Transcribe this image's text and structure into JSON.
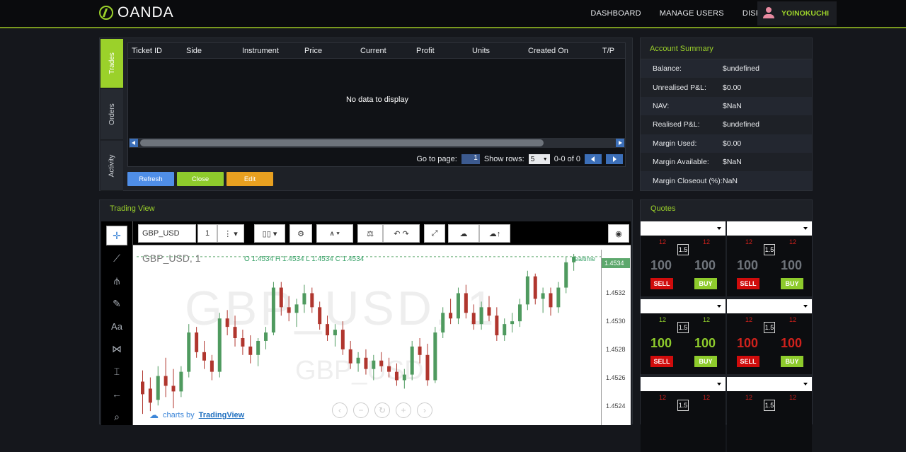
{
  "brand": {
    "name": "OANDA"
  },
  "nav": {
    "items": [
      "DASHBOARD",
      "MANAGE USERS",
      "DISPUTE MANAGEMENT"
    ],
    "username": "YOINOKUCHI"
  },
  "trades": {
    "tabs": [
      "Trades",
      "Orders",
      "Activity"
    ],
    "columns": [
      "Ticket ID",
      "Side",
      "Instrument",
      "Price",
      "Current",
      "Profit",
      "Units",
      "Created On",
      "T/P"
    ],
    "empty_text": "No data to display",
    "pager": {
      "goto_label": "Go to page:",
      "page": "1",
      "rows_label": "Show rows:",
      "rows": "5",
      "range": "0-0 of 0"
    },
    "buttons": {
      "refresh": "Refresh",
      "close": "Close",
      "edit": "Edit"
    }
  },
  "account": {
    "title": "Account Summary",
    "rows": [
      {
        "label": "Balance:",
        "value": "$undefined"
      },
      {
        "label": "Unrealised P&L:",
        "value": "$0.00"
      },
      {
        "label": "NAV:",
        "value": "$NaN"
      },
      {
        "label": "Realised P&L:",
        "value": "$undefined"
      },
      {
        "label": "Margin Used:",
        "value": "$0.00"
      },
      {
        "label": "Margin Available:",
        "value": "$NaN"
      },
      {
        "label": "Margin Closeout (%):",
        "value": "NaN"
      }
    ]
  },
  "trading_view": {
    "title": "Trading View",
    "symbol": "GBP_USD",
    "interval": "1",
    "legend": "GBP_USD, 1",
    "ohlc": "O 1.4534  H 1.4534  L 1.4534  C 1.4534",
    "watermark_big": "GBP_USD, 1",
    "watermark_small": "GBP_USD",
    "last_price": "1.4534",
    "price_ticks": [
      "1.4532",
      "1.4530",
      "1.4528",
      "1.4526",
      "1.4524"
    ],
    "realtime_label": "realtime",
    "credit_prefix": "charts by",
    "credit_brand": "TradingView",
    "candles": [
      [
        1.45251,
        1.45259,
        1.45228,
        1.45242
      ],
      [
        1.45246,
        1.45254,
        1.4523,
        1.45236
      ],
      [
        1.45238,
        1.45262,
        1.45234,
        1.45255
      ],
      [
        1.45255,
        1.45268,
        1.4524,
        1.45248
      ],
      [
        1.45248,
        1.4526,
        1.45232,
        1.45244
      ],
      [
        1.45244,
        1.45262,
        1.4524,
        1.45258
      ],
      [
        1.45258,
        1.45292,
        1.45254,
        1.45286
      ],
      [
        1.45286,
        1.4529,
        1.45268,
        1.45272
      ],
      [
        1.45272,
        1.4528,
        1.4526,
        1.45266
      ],
      [
        1.45266,
        1.4527,
        1.45252,
        1.45258
      ],
      [
        1.45258,
        1.453,
        1.45254,
        1.45296
      ],
      [
        1.45296,
        1.45302,
        1.45284,
        1.4529
      ],
      [
        1.4529,
        1.45298,
        1.45276,
        1.45282
      ],
      [
        1.45282,
        1.45288,
        1.4527,
        1.45276
      ],
      [
        1.45276,
        1.45284,
        1.45264,
        1.4527
      ],
      [
        1.4527,
        1.45282,
        1.45262,
        1.4528
      ],
      [
        1.4528,
        1.4529,
        1.45274,
        1.45286
      ],
      [
        1.45286,
        1.45322,
        1.45284,
        1.45318
      ],
      [
        1.45318,
        1.45322,
        1.45298,
        1.45304
      ],
      [
        1.45304,
        1.45312,
        1.45294,
        1.453
      ],
      [
        1.453,
        1.4531,
        1.4529,
        1.45306
      ],
      [
        1.45306,
        1.4532,
        1.453,
        1.45314
      ],
      [
        1.45314,
        1.45318,
        1.453,
        1.45304
      ],
      [
        1.45304,
        1.45308,
        1.45288,
        1.45292
      ],
      [
        1.45292,
        1.45298,
        1.4528,
        1.45284
      ],
      [
        1.45284,
        1.45292,
        1.45276,
        1.45288
      ],
      [
        1.45288,
        1.45294,
        1.4527,
        1.45274
      ],
      [
        1.45274,
        1.4528,
        1.4526,
        1.45264
      ],
      [
        1.45264,
        1.45272,
        1.45258,
        1.45268
      ],
      [
        1.45268,
        1.45274,
        1.45256,
        1.4526
      ],
      [
        1.4526,
        1.4527,
        1.45252,
        1.45266
      ],
      [
        1.45266,
        1.45272,
        1.45258,
        1.45262
      ],
      [
        1.45262,
        1.45268,
        1.45254,
        1.45258
      ],
      [
        1.45258,
        1.45264,
        1.45248,
        1.45252
      ],
      [
        1.45252,
        1.4526,
        1.45246,
        1.45256
      ],
      [
        1.45256,
        1.4528,
        1.45252,
        1.45276
      ],
      [
        1.45276,
        1.45282,
        1.45264,
        1.4527
      ],
      [
        1.4527,
        1.45278,
        1.45248,
        1.45252
      ],
      [
        1.45252,
        1.4529,
        1.4525,
        1.45286
      ],
      [
        1.45286,
        1.45304,
        1.45282,
        1.453
      ],
      [
        1.453,
        1.4531,
        1.45292,
        1.45296
      ],
      [
        1.45296,
        1.45318,
        1.45292,
        1.45314
      ],
      [
        1.45314,
        1.4532,
        1.45296,
        1.453
      ],
      [
        1.453,
        1.45306,
        1.45288,
        1.45292
      ],
      [
        1.45292,
        1.45308,
        1.45288,
        1.45304
      ],
      [
        1.45304,
        1.45312,
        1.45294,
        1.45298
      ],
      [
        1.45298,
        1.45304,
        1.4528,
        1.45284
      ],
      [
        1.45284,
        1.45296,
        1.4528,
        1.45292
      ],
      [
        1.45292,
        1.453,
        1.45286,
        1.45294
      ],
      [
        1.45294,
        1.4531,
        1.4529,
        1.45306
      ],
      [
        1.45306,
        1.4533,
        1.45302,
        1.45326
      ],
      [
        1.45326,
        1.45328,
        1.45306,
        1.4531
      ],
      [
        1.4531,
        1.45318,
        1.453,
        1.45314
      ],
      [
        1.45314,
        1.45318,
        1.45298,
        1.45304
      ],
      [
        1.45304,
        1.45322,
        1.453,
        1.45318
      ],
      [
        1.45318,
        1.4534,
        1.45314,
        1.45336
      ],
      [
        1.45336,
        1.45342,
        1.4533,
        1.4534
      ]
    ]
  },
  "quotes": {
    "title": "Quotes",
    "cells": [
      {
        "left_small": "12",
        "right_small": "12",
        "spread": "1.5",
        "bid": "100",
        "ask": "100",
        "style": "dim",
        "sell": "SELL",
        "buy": "BUY"
      },
      {
        "left_small": "12",
        "right_small": "12",
        "spread": "1.5",
        "bid": "100",
        "ask": "100",
        "style": "dim",
        "sell": "SELL",
        "buy": "BUY"
      },
      {
        "left_small": "12",
        "right_small": "12",
        "spread": "1.5",
        "bid": "100",
        "ask": "100",
        "style": "green",
        "sell": "SELL",
        "buy": "BUY"
      },
      {
        "left_small": "12",
        "right_small": "12",
        "spread": "1.5",
        "bid": "100",
        "ask": "100",
        "style": "red",
        "sell": "SELL",
        "buy": "BUY"
      },
      {
        "left_small": "12",
        "right_small": "12",
        "spread": "1.5",
        "bid": "",
        "ask": "",
        "style": "dim",
        "sell": "",
        "buy": ""
      },
      {
        "left_small": "12",
        "right_small": "12",
        "spread": "1.5",
        "bid": "",
        "ask": "",
        "style": "dim",
        "sell": "",
        "buy": ""
      }
    ]
  },
  "colors": {
    "accent": "#9bd12a",
    "sell": "#d00c0c",
    "buy": "#8ecb2c",
    "up": "#4f9a5f",
    "down": "#b0362e"
  }
}
